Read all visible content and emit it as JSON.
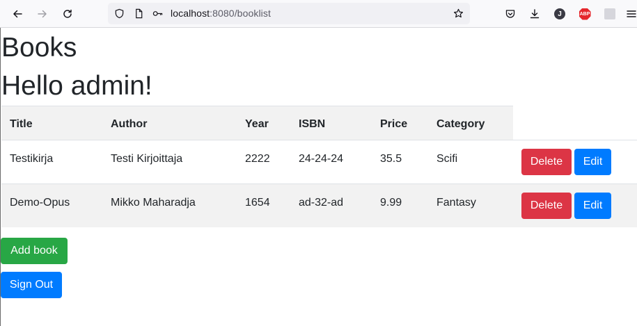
{
  "browser": {
    "url_host": "localhost",
    "url_rest": ":8080/booklist",
    "profile_initial": "J",
    "abp_label": "ABP"
  },
  "page": {
    "heading": "Books",
    "greeting": "Hello admin!"
  },
  "table": {
    "headers": [
      "Title",
      "Author",
      "Year",
      "ISBN",
      "Price",
      "Category"
    ],
    "rows": [
      {
        "title": "Testikirja",
        "author": "Testi Kirjoittaja",
        "year": "2222",
        "isbn": "24-24-24",
        "price": "35.5",
        "category": "Scifi"
      },
      {
        "title": "Demo-Opus",
        "author": "Mikko Maharadja",
        "year": "1654",
        "isbn": "ad-32-ad",
        "price": "9.99",
        "category": "Fantasy"
      }
    ],
    "delete_label": "Delete",
    "edit_label": "Edit"
  },
  "actions": {
    "add_book": "Add book",
    "sign_out": "Sign Out"
  },
  "colors": {
    "danger": "#dc3545",
    "primary": "#007bff",
    "success": "#28a745"
  }
}
